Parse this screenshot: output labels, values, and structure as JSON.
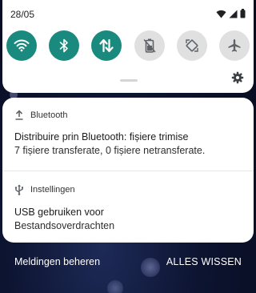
{
  "status_bar": {
    "date": "28/05",
    "icons": [
      "wifi-signal-icon",
      "cell-signal-icon",
      "battery-icon"
    ]
  },
  "quick_settings": {
    "tiles": [
      {
        "icon": "wifi-icon",
        "state": "on"
      },
      {
        "icon": "bluetooth-icon",
        "state": "on"
      },
      {
        "icon": "mobile-data-icon",
        "state": "on"
      },
      {
        "icon": "battery-saver-icon",
        "state": "off"
      },
      {
        "icon": "auto-rotate-icon",
        "state": "off"
      },
      {
        "icon": "airplane-mode-icon",
        "state": "off"
      }
    ],
    "accent_color": "#1a8a7e"
  },
  "notifications": [
    {
      "app": "Bluetooth",
      "icon": "upload-arrow-icon",
      "title": "Distribuire prin Bluetooth: fișiere trimise",
      "text": "7 fișiere transferate, 0 fișiere netransferate."
    },
    {
      "app": "Instellingen",
      "icon": "usb-icon",
      "title": "USB gebruiken voor",
      "text": "Bestandsoverdrachten"
    }
  ],
  "actions": {
    "manage": "Meldingen beheren",
    "clear_all": "ALLES WISSEN"
  }
}
